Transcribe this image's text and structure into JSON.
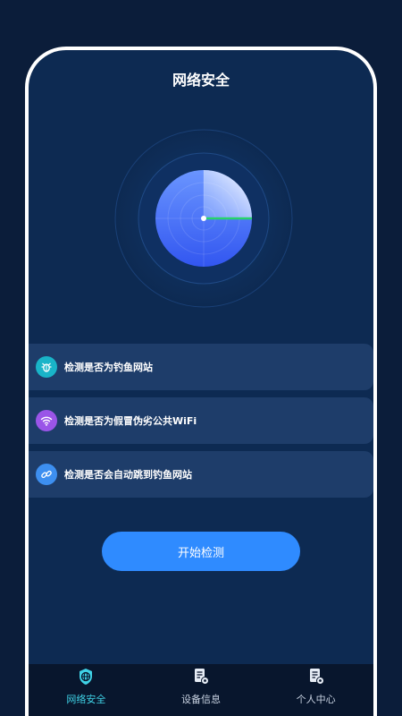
{
  "header": {
    "title": "网络安全"
  },
  "checks": [
    {
      "label": "检测是否为钓鱼网站",
      "icon": "bug-icon",
      "color": "#19b4c8"
    },
    {
      "label": "检测是否为假冒伪劣公共WiFi",
      "icon": "wifi-icon",
      "color": "#9a55e8"
    },
    {
      "label": "检测是否会自动跳到钓鱼网站",
      "icon": "link-icon",
      "color": "#3d8ff0"
    }
  ],
  "action": {
    "start_label": "开始检测"
  },
  "tabs": [
    {
      "label": "网络安全",
      "icon": "shield-globe-icon",
      "active": true
    },
    {
      "label": "设备信息",
      "icon": "document-gear-icon",
      "active": false
    },
    {
      "label": "个人中心",
      "icon": "document-gear-icon",
      "active": false
    }
  ],
  "colors": {
    "accent": "#2f8bff",
    "tab_active": "#3fd2e6",
    "tab_inactive": "#c9d3e2",
    "background": "#0d2a52"
  }
}
